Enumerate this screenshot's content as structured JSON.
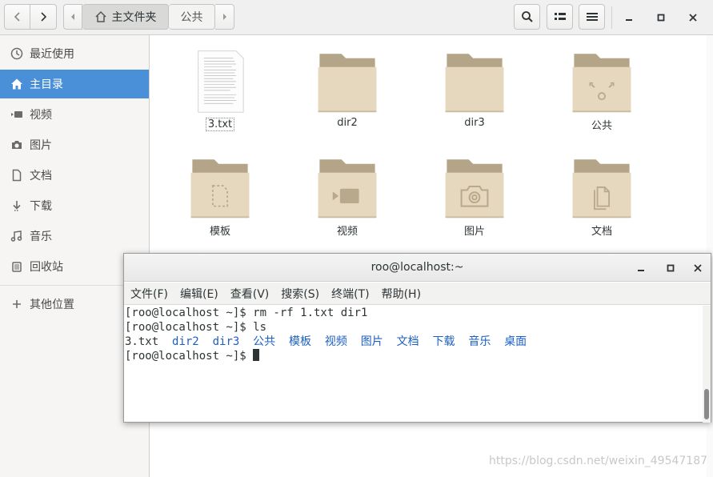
{
  "header": {
    "path": [
      "主文件夹",
      "公共"
    ]
  },
  "sidebar": {
    "items": [
      {
        "label": "最近使用",
        "icon": "clock-icon"
      },
      {
        "label": "主目录",
        "icon": "home-icon",
        "active": true
      },
      {
        "label": "视频",
        "icon": "video-icon"
      },
      {
        "label": "图片",
        "icon": "camera-icon"
      },
      {
        "label": "文档",
        "icon": "document-icon"
      },
      {
        "label": "下载",
        "icon": "download-icon"
      },
      {
        "label": "音乐",
        "icon": "music-icon"
      },
      {
        "label": "回收站",
        "icon": "trash-icon"
      },
      {
        "label": "其他位置",
        "icon": "plus-icon"
      }
    ]
  },
  "files": [
    {
      "name": "3.txt",
      "type": "text-file"
    },
    {
      "name": "dir2",
      "type": "folder"
    },
    {
      "name": "dir3",
      "type": "folder"
    },
    {
      "name": "公共",
      "type": "folder-share"
    },
    {
      "name": "模板",
      "type": "folder-template"
    },
    {
      "name": "视频",
      "type": "folder-video"
    },
    {
      "name": "图片",
      "type": "folder-pictures"
    },
    {
      "name": "文档",
      "type": "folder-documents"
    }
  ],
  "terminal": {
    "title": "roo@localhost:~",
    "menu": [
      "文件(F)",
      "编辑(E)",
      "查看(V)",
      "搜索(S)",
      "终端(T)",
      "帮助(H)"
    ],
    "lines": [
      "[roo@localhost ~]$ rm -rf 1.txt dir1",
      "[roo@localhost ~]$ ls"
    ],
    "ls_output": {
      "plain": "3.txt",
      "dirs": [
        "dir2",
        "dir3",
        "公共",
        "模板",
        "视频",
        "图片",
        "文档",
        "下载",
        "音乐",
        "桌面"
      ]
    },
    "prompt": "[roo@localhost ~]$ "
  },
  "watermark": "https://blog.csdn.net/weixin_49547187",
  "colors": {
    "accent": "#4a90d9",
    "folder": "#e6d7bf",
    "dir_text": "#1d5fc4"
  }
}
